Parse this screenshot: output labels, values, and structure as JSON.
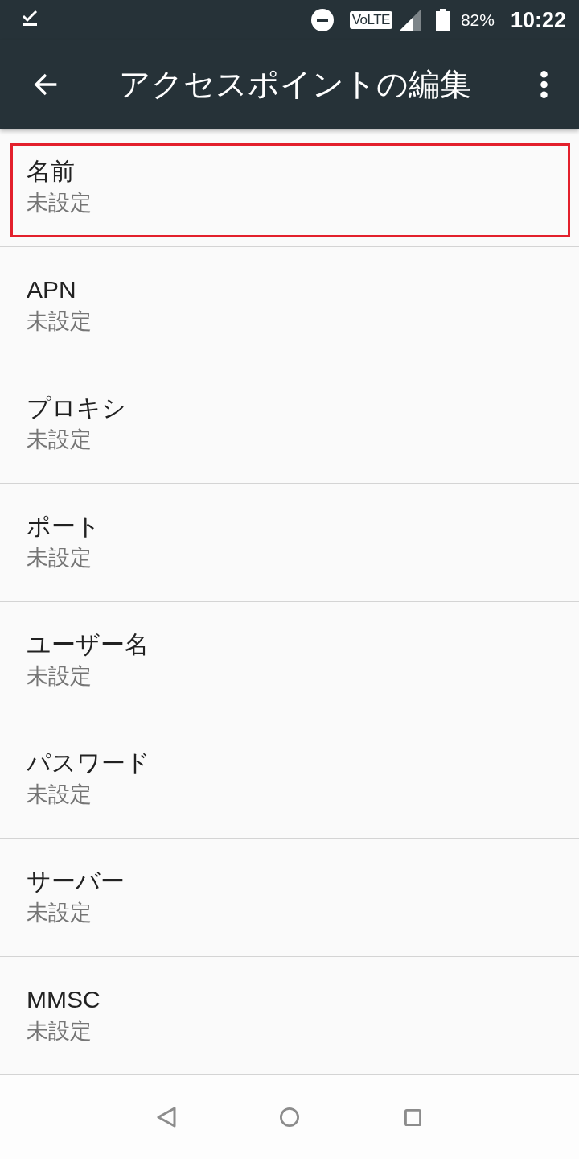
{
  "status_bar": {
    "volte": "VoLTE",
    "battery": "82%",
    "time": "10:22"
  },
  "toolbar": {
    "title": "アクセスポイントの編集"
  },
  "items": [
    {
      "title": "名前",
      "summary": "未設定",
      "highlighted": true
    },
    {
      "title": "APN",
      "summary": "未設定",
      "highlighted": false
    },
    {
      "title": "プロキシ",
      "summary": "未設定",
      "highlighted": false
    },
    {
      "title": "ポート",
      "summary": "未設定",
      "highlighted": false
    },
    {
      "title": "ユーザー名",
      "summary": "未設定",
      "highlighted": false
    },
    {
      "title": "パスワード",
      "summary": "未設定",
      "highlighted": false
    },
    {
      "title": "サーバー",
      "summary": "未設定",
      "highlighted": false
    },
    {
      "title": "MMSC",
      "summary": "未設定",
      "highlighted": false
    }
  ]
}
